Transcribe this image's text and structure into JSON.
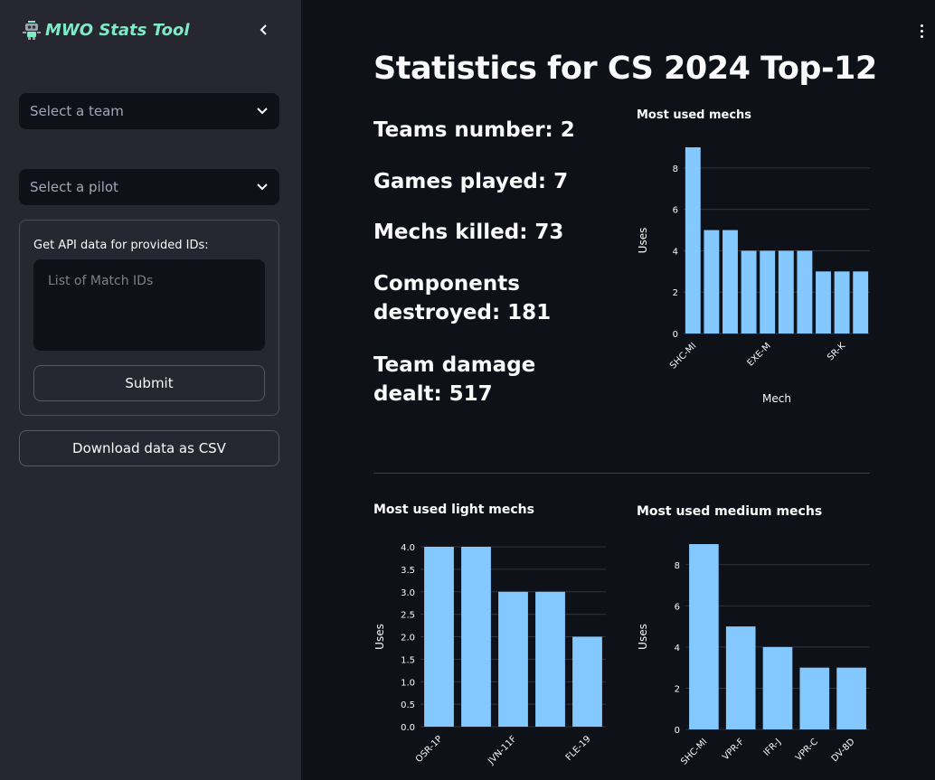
{
  "sidebar": {
    "app_title": "MWO Stats Tool",
    "logo_icon": "robot-icon",
    "collapse_icon": "chevron-left-icon",
    "team_select": {
      "placeholder": "Select a team"
    },
    "pilot_select": {
      "placeholder": "Select a pilot"
    },
    "api_form": {
      "label": "Get API data for provided IDs:",
      "textarea_placeholder": "List of Match IDs",
      "submit_label": "Submit"
    },
    "download_label": "Download data as CSV"
  },
  "main": {
    "title": "Statistics for CS 2024 Top-12",
    "stats": [
      {
        "label": "Teams number: 2"
      },
      {
        "label": "Games played: 7"
      },
      {
        "label": "Mechs killed: 73"
      },
      {
        "label": "Components destroyed: 181"
      },
      {
        "label": "Team damage dealt: 517"
      }
    ]
  },
  "chart_data": [
    {
      "type": "bar",
      "title": "Most used mechs",
      "xlabel": "Mech",
      "ylabel": "Uses",
      "categories": [
        "SHC-MI",
        "",
        "",
        "",
        "EXE-M",
        "",
        "",
        "",
        "SR-K",
        ""
      ],
      "values": [
        9,
        5,
        5,
        4,
        4,
        4,
        4,
        3,
        3,
        3
      ],
      "yticks": [
        0,
        2,
        4,
        6,
        8
      ],
      "ylim": [
        0,
        9
      ],
      "grid": true,
      "color": "#83c9ff"
    },
    {
      "type": "bar",
      "title": "Most used light mechs",
      "xlabel": "",
      "ylabel": "Uses",
      "categories": [
        "OSR-1P",
        "",
        "JVN-11F",
        "",
        "FLE-19"
      ],
      "values": [
        4,
        4,
        3,
        3,
        2
      ],
      "yticks": [
        "0.0",
        "0.5",
        "1.0",
        "1.5",
        "2.0",
        "2.5",
        "3.0",
        "3.5",
        "4.0"
      ],
      "ylim": [
        0,
        4
      ],
      "grid": true,
      "color": "#83c9ff"
    },
    {
      "type": "bar",
      "title": "Most used medium mechs",
      "xlabel": "",
      "ylabel": "Uses",
      "categories": [
        "SHC-MI",
        "VPR-F",
        "IFR-J",
        "VPR-C",
        "DV-8D"
      ],
      "values": [
        9,
        5,
        4,
        3,
        3
      ],
      "yticks": [
        0,
        2,
        4,
        6,
        8
      ],
      "ylim": [
        0,
        9
      ],
      "grid": true,
      "color": "#83c9ff"
    }
  ]
}
